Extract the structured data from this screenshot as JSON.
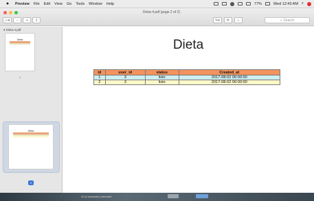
{
  "menubar": {
    "apple": "",
    "items": [
      "Preview",
      "File",
      "Edit",
      "View",
      "Go",
      "Tools",
      "Window",
      "Help"
    ],
    "status_battery": "77%",
    "clock": "Wed 12:43 AM"
  },
  "window": {
    "title": "Dieta-4.pdf (page 2 of 2)",
    "search_placeholder": "Search"
  },
  "sidebar": {
    "file_name": "Dieta-4.pdf",
    "page1_number": "1",
    "page2_number": "2",
    "thumb_title": "Dieta"
  },
  "document": {
    "title": "Dieta",
    "columns": [
      "id",
      "user_id",
      "status",
      "Created_at"
    ],
    "rows": [
      [
        "1",
        "3",
        "listo",
        "2017-08-02 00:00:00"
      ],
      [
        "2",
        "3",
        "listo",
        "2017-08-02 00:00:00"
      ]
    ],
    "colors": {
      "header": "#f3935e",
      "row_odd": "#cfeef0",
      "row_even": "#fbf7c8"
    }
  },
  "dock": {
    "text": "32 (Il character) selected"
  }
}
